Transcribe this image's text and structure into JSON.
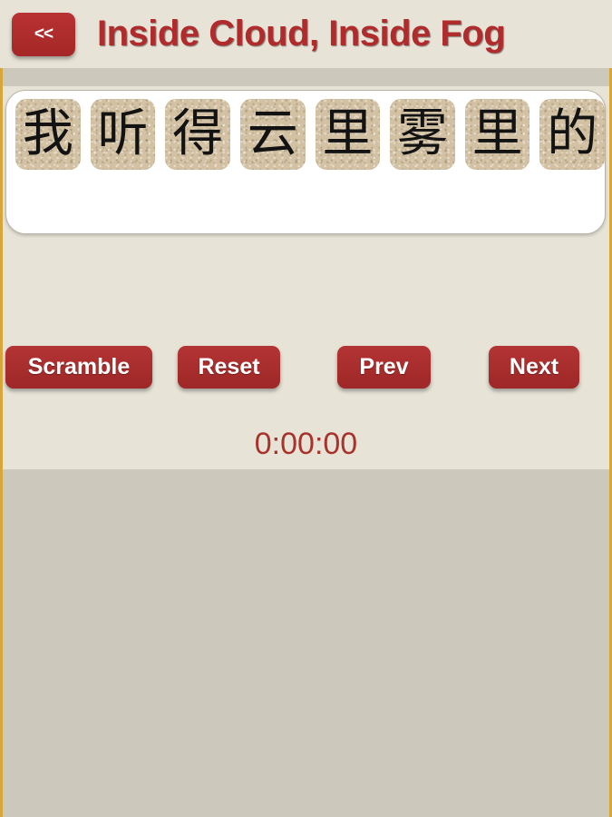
{
  "header": {
    "back_label": "<<",
    "title": "Inside Cloud, Inside Fog"
  },
  "sentence": {
    "tiles": [
      {
        "char": "我"
      },
      {
        "char": "听"
      },
      {
        "char": "得"
      },
      {
        "char": "云"
      },
      {
        "char": "里"
      },
      {
        "char": "雾"
      },
      {
        "char": "里"
      },
      {
        "char": "的"
      }
    ]
  },
  "controls": {
    "scramble_label": "Scramble",
    "reset_label": "Reset",
    "prev_label": "Prev",
    "next_label": "Next"
  },
  "timer": {
    "value": "0:00:00"
  },
  "colors": {
    "accent_red": "#a92d2d",
    "title_red": "#b02b2b",
    "timer_red": "#a8332c",
    "panel_cream": "#e7e4d7",
    "page_grey": "#ccc8bb",
    "tile_tan": "#d2c1a3",
    "edge_gold": "#d8a53a"
  }
}
